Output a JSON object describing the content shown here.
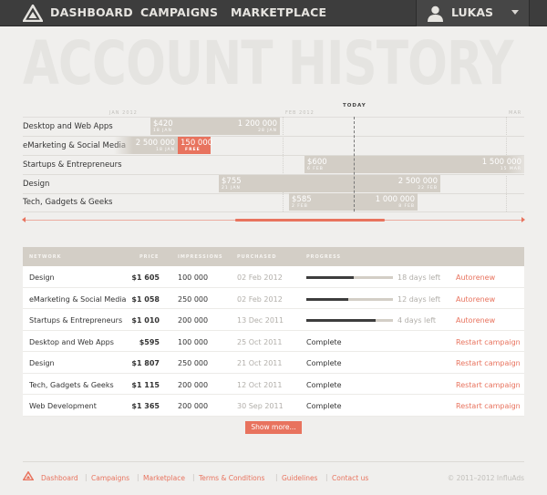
{
  "nav": {
    "items": [
      "Dashboard",
      "Campaigns",
      "Marketplace"
    ],
    "user": "Lukas"
  },
  "page_title": "Account History",
  "timeline": {
    "today_label": "Today",
    "months": [
      "Jan 2012",
      "Feb 2012",
      "Mar"
    ],
    "rows": [
      {
        "label": "Desktop and Web Apps",
        "price": "$420",
        "impressions": "1 200 000",
        "start": "18 Jan",
        "end": "28 Jan"
      },
      {
        "label": "eMarketing & Social Media",
        "price": "2 500 000",
        "start": "18 Jan",
        "highlight_price": "150 000",
        "highlight_badge": "Free"
      },
      {
        "label": "Startups & Entrepreneurs",
        "price": "$600",
        "impressions": "1 500 000",
        "start": "6 Feb",
        "end": "15 Mar"
      },
      {
        "label": "Design",
        "price": "$755",
        "impressions": "2 500 000",
        "start": "21 Jan",
        "end": "22 Feb"
      },
      {
        "label": "Tech, Gadgets & Geeks",
        "price": "$585",
        "impressions": "1 000 000",
        "start": "2 Feb",
        "end": "8 Feb"
      }
    ]
  },
  "table": {
    "headers": [
      "Network",
      "Price",
      "Impressions",
      "Purchased",
      "Progress"
    ],
    "rows": [
      {
        "network": "Design",
        "price": "$1 605",
        "impressions": "100 000",
        "purchased": "02 Feb 2012",
        "status": "",
        "progress": 0.55,
        "remaining": "18 days left",
        "action": "Autorenew"
      },
      {
        "network": "eMarketing & Social Media",
        "price": "$1 058",
        "impressions": "250 000",
        "purchased": "02 Feb 2012",
        "status": "",
        "progress": 0.48,
        "remaining": "12 days left",
        "action": "Autorenew"
      },
      {
        "network": "Startups & Entrepreneurs",
        "price": "$1 010",
        "impressions": "200 000",
        "purchased": "13 Dec 2011",
        "status": "",
        "progress": 0.8,
        "remaining": "4 days left",
        "action": "Autorenew"
      },
      {
        "network": "Desktop and Web Apps",
        "price": "$595",
        "impressions": "100 000",
        "purchased": "25 Oct 2011",
        "status": "Complete",
        "action": "Restart campaign"
      },
      {
        "network": "Design",
        "price": "$1 807",
        "impressions": "250 000",
        "purchased": "21 Oct 2011",
        "status": "Complete",
        "action": "Restart campaign"
      },
      {
        "network": "Tech, Gadgets & Geeks",
        "price": "$1 115",
        "impressions": "200 000",
        "purchased": "12 Oct 2011",
        "status": "Complete",
        "action": "Restart campaign"
      },
      {
        "network": "Web Development",
        "price": "$1 365",
        "impressions": "200 000",
        "purchased": "30 Sep 2011",
        "status": "Complete",
        "action": "Restart campaign"
      }
    ]
  },
  "show_more": "Show more...",
  "footer": {
    "links": [
      "Dashboard",
      "Campaigns",
      "Marketplace",
      "Terms & Conditions",
      "Guidelines",
      "Contact us"
    ],
    "copyright": "© 2011–2012 InfluAds"
  },
  "colors": {
    "accent": "#e8735e",
    "nav_bg": "#3d3d3d",
    "bar": "#d3cec6"
  },
  "icons": {
    "logo": "triangle-logo-icon",
    "avatar": "user-avatar-icon",
    "dropdown": "caret-down-icon"
  }
}
